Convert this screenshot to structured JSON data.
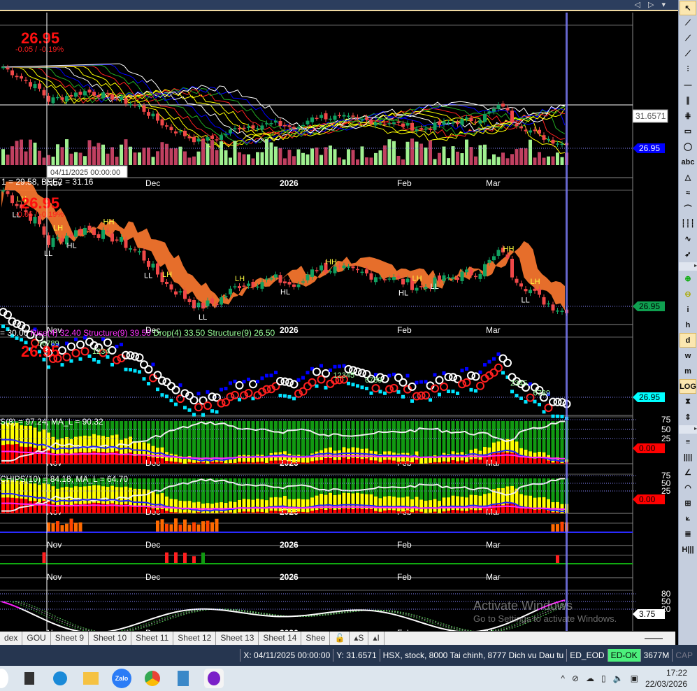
{
  "window": {
    "nav_arrows": "◁ ▷ ▾"
  },
  "price": {
    "last": "26.95",
    "change": "-0.05 / -0.19%"
  },
  "axis": {
    "months": [
      "Nov",
      "Dec",
      "2026",
      "Feb",
      "Mar"
    ],
    "cursor_date": "04/11/2025 00:00:00",
    "cursor_price": "31.6571"
  },
  "panes": {
    "p1": {
      "last_tag": "26.95",
      "tag_color": "#0000ff"
    },
    "p2": {
      "title": "1 = 29.58, BEE2 = 31.16",
      "last_tag": "26.95",
      "tag_color": "#0fa050",
      "swing_labels": [
        {
          "t": "LH",
          "i": 4
        },
        {
          "t": "LL",
          "i": 3
        },
        {
          "t": "LH",
          "i": 12
        },
        {
          "t": "LL",
          "i": 10
        },
        {
          "t": "HL",
          "i": 15
        },
        {
          "t": "HH",
          "i": 23
        },
        {
          "t": "LL",
          "i": 32
        },
        {
          "t": "LH",
          "i": 36
        },
        {
          "t": "LL",
          "i": 44
        },
        {
          "t": "LH",
          "i": 52
        },
        {
          "t": "HL",
          "i": 62
        },
        {
          "t": "HH",
          "i": 72
        },
        {
          "t": "HL",
          "i": 88
        },
        {
          "t": "LH",
          "i": 91
        },
        {
          "t": "LL",
          "i": 95
        },
        {
          "t": "HH",
          "i": 111
        },
        {
          "t": "LH",
          "i": 117
        },
        {
          "t": "LL",
          "i": 115
        }
      ]
    },
    "p3": {
      "title_parts": [
        {
          "t": "= 30.06 ",
          "c": "#ffffff"
        },
        {
          "t": "Rise(4) 32.40 Structure(9) 39.50 ",
          "c": "#ff33ff"
        },
        {
          "t": "Drop(4) 33.50 Structure(9) 26.50",
          "c": "#99ff99"
        }
      ],
      "last_tag": "26.95",
      "tag_color": "#00ffff",
      "counts": [
        "1234",
        "56789",
        "12345",
        "6789",
        "2345",
        "6789"
      ]
    },
    "p4": {
      "title": "S(8) = 97.24, MA_L = 90.32",
      "levels": [
        "75",
        "50",
        "25"
      ],
      "last_tag": "0.00"
    },
    "p5": {
      "title": "CHIPS(10) = 84.18, MA_L = 64.70",
      "levels": [
        "75",
        "50",
        "25"
      ],
      "last_tag": "0.00"
    },
    "p8": {
      "levels": [
        "80",
        "50",
        "20"
      ],
      "last_tag": "3.75"
    }
  },
  "chart_data": {
    "type": "candlestick",
    "note": "approximate daily closes by bar",
    "anchors": [
      [
        0,
        34.0
      ],
      [
        8,
        32.0
      ],
      [
        10,
        31.0
      ],
      [
        18,
        31.8
      ],
      [
        25,
        31.2
      ],
      [
        30,
        30.4
      ],
      [
        36,
        28.6
      ],
      [
        43,
        27.3
      ],
      [
        47,
        27.6
      ],
      [
        52,
        28.6
      ],
      [
        60,
        28.9
      ],
      [
        65,
        28.4
      ],
      [
        68,
        29.6
      ],
      [
        75,
        29.4
      ],
      [
        85,
        29.0
      ],
      [
        92,
        28.4
      ],
      [
        97,
        28.9
      ],
      [
        105,
        29.4
      ],
      [
        110,
        30.6
      ],
      [
        112,
        29.2
      ],
      [
        118,
        27.8
      ],
      [
        124,
        26.95
      ]
    ]
  },
  "tabs": [
    "dex",
    "GOU",
    "Sheet 9",
    "Sheet 10",
    "Sheet 11",
    "Sheet 12",
    "Sheet 13",
    "Sheet 14",
    "Shee"
  ],
  "tab_controls": [
    "🔓",
    "▴S",
    "▴I"
  ],
  "status": {
    "x": "X: 04/11/2025 00:00:00",
    "y": "Y: 31.6571",
    "symbol": "HSX, stock, 8000 Tai chinh, 8777 Dich vu Dau tu",
    "db": "ED_EOD",
    "conn": "ED-OK",
    "mem": "3677M",
    "cap": "CAP"
  },
  "toolbar": [
    "↖",
    "⟋",
    "⟋",
    "⟋",
    "⫶",
    "—",
    "∥",
    "⋕",
    "▭",
    "◯",
    "abc",
    "△",
    "≈",
    "⌒",
    "┆┆┆",
    "∿",
    "➶",
    "⊕",
    "⊖",
    "i",
    "h",
    "d",
    "w",
    "m",
    "LOG",
    "⧗",
    "⇕",
    "≡",
    "||||",
    "∠",
    "◠",
    "⊞",
    "⟀",
    "≣",
    "H|||"
  ],
  "taskbar": {
    "apps": [
      "Zalo"
    ],
    "time": "17:22",
    "date": "22/03/2026"
  },
  "watermark": {
    "line1": "Activate Windows",
    "line2": "Go to Settings to activate Windows."
  }
}
